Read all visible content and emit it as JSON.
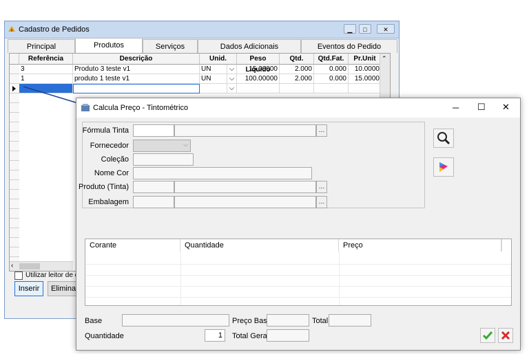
{
  "back_window": {
    "title": "Cadastro de Pedidos",
    "tabs": [
      {
        "label": "Principal"
      },
      {
        "label": "Produtos"
      },
      {
        "label": "Serviços"
      },
      {
        "label": "Dados Adicionais"
      },
      {
        "label": "Eventos do Pedido"
      }
    ],
    "grid": {
      "headers": [
        "Referência",
        "Descrição",
        "Unid.",
        "Peso Liquido",
        "Qtd.",
        "Qtd.Fat.",
        "Pr.Unit"
      ],
      "rows": [
        {
          "ref": "3",
          "desc": "Produto 3 teste v1",
          "unid": "UN",
          "peso": "15.00000",
          "qtd": "2.000",
          "qtdfat": "0.000",
          "prunit": "10.0000"
        },
        {
          "ref": "1",
          "desc": "produto 1 teste v1",
          "unid": "UN",
          "peso": "100.00000",
          "qtd": "2.000",
          "qtdfat": "0.000",
          "prunit": "15.0000"
        }
      ]
    },
    "checkbox_label": "Utilizar leitor de cód",
    "insert_label": "Inserir",
    "delete_label": "Elimina"
  },
  "dialog": {
    "title": "Calcula Preço - Tintométrico",
    "labels": {
      "formula": "Fórmula Tinta",
      "fornecedor": "Fornecedor",
      "colecao": "Coleção",
      "nome_cor": "Nome Cor",
      "produto": "Produto (Tinta)",
      "embalagem": "Embalagem"
    },
    "table_headers": [
      "Corante",
      "Quantidade",
      "Preço"
    ],
    "footer": {
      "base_label": "Base",
      "preco_base_label": "Preço Base",
      "total_label": "Total",
      "quantidade_label": "Quantidade",
      "quantidade_value": "1",
      "total_geral_label": "Total Geral"
    },
    "icons": {
      "search": "magnifier-icon",
      "color": "color-palette-icon",
      "confirm": "check-icon",
      "cancel": "x-icon"
    },
    "colors": {
      "confirm": "#3aa635",
      "cancel": "#d92b2b"
    }
  }
}
